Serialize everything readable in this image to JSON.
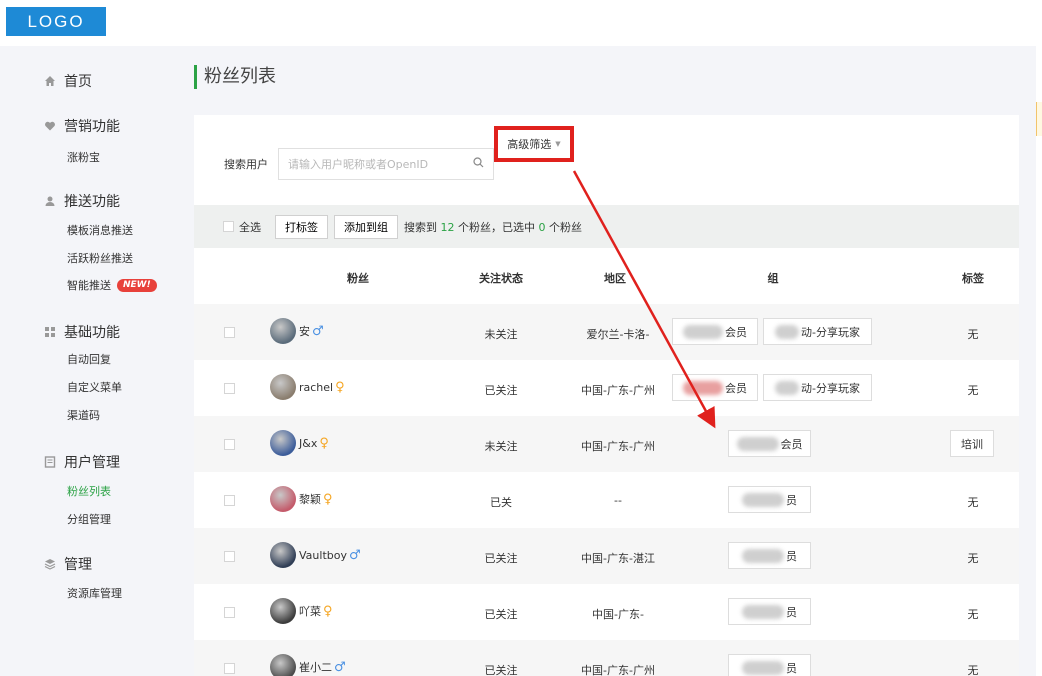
{
  "logo": "LOGO",
  "sidebar": {
    "home": "首页",
    "marketing": {
      "title": "营销功能",
      "items": [
        "涨粉宝"
      ]
    },
    "push": {
      "title": "推送功能",
      "items": [
        "模板消息推送",
        "活跃粉丝推送",
        "智能推送"
      ],
      "new_badge": "NEW!"
    },
    "basic": {
      "title": "基础功能",
      "items": [
        "自动回复",
        "自定义菜单",
        "渠道码"
      ]
    },
    "users": {
      "title": "用户管理",
      "items": [
        "粉丝列表",
        "分组管理"
      ]
    },
    "manage": {
      "title": "管理",
      "items": [
        "资源库管理"
      ]
    }
  },
  "page_title": "粉丝列表",
  "search": {
    "label": "搜索用户",
    "placeholder": "请输入用户昵称或者OpenID",
    "filter_label": "高级筛选"
  },
  "toolbar": {
    "select_all": "全选",
    "tag_button": "打标签",
    "group_button": "添加到组",
    "count_prefix": "搜索到",
    "found": "12",
    "count_mid": "个粉丝，已选中",
    "selected": "0",
    "count_suffix": "个粉丝"
  },
  "table": {
    "headers": [
      "粉丝",
      "关注状态",
      "地区",
      "组",
      "标签"
    ],
    "rows": [
      {
        "name": "安",
        "gender": "male",
        "status": "未关注",
        "region": "爱尔兰-卡洛-",
        "groups": [
          "会员",
          "动-分享玩家"
        ],
        "tag": "无"
      },
      {
        "name": "rachel",
        "gender": "female",
        "status": "已关注",
        "region": "中国-广东-广州",
        "groups": [
          "会员",
          "动-分享玩家"
        ],
        "tag": "无"
      },
      {
        "name": "J&x",
        "gender": "female",
        "status": "未关注",
        "region": "中国-广东-广州",
        "groups": [
          "会员"
        ],
        "tag": "培训"
      },
      {
        "name": "黎颖",
        "gender": "female",
        "status": "已关",
        "region": "--",
        "groups": [
          "员"
        ],
        "tag": "无"
      },
      {
        "name": "Vaultboy",
        "gender": "male",
        "status": "已关注",
        "region": "中国-广东-湛江",
        "groups": [
          "员"
        ],
        "tag": "无"
      },
      {
        "name": "吖菜",
        "gender": "female",
        "status": "已关注",
        "region": "中国-广东-",
        "groups": [
          "员"
        ],
        "tag": "无"
      },
      {
        "name": "崔小二",
        "gender": "male",
        "status": "已关注",
        "region": "中国-广东-广州",
        "groups": [
          "员"
        ],
        "tag": "无"
      }
    ]
  },
  "colors": {
    "accent": "#2ba245",
    "logo_bg": "#1e8ad6",
    "highlight": "#e0211d"
  },
  "icons": {
    "home": "home-icon",
    "marketing": "heart-icon",
    "push": "user-icon",
    "basic": "grid-icon",
    "users": "document-icon",
    "manage": "layers-icon",
    "search": "search-icon"
  }
}
